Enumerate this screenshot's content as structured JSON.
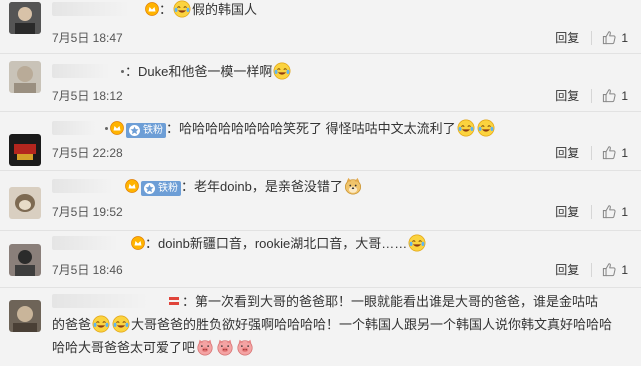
{
  "comments": [
    {
      "name_width": 88,
      "sep": "：",
      "pre_emoji": "",
      "text": "假的韩国人",
      "post_emojis": [],
      "date": "7月5日 18:47",
      "reply_label": "回复",
      "like_count": "1"
    },
    {
      "sep": "：",
      "text": "Duke和他爸一模一样啊",
      "date": "7月5日 18:12",
      "reply_label": "回复",
      "like_count": "1"
    },
    {
      "sep": "：",
      "text": "哈哈哈哈哈哈哈哈笑死了 得怪咕咕中文太流利了",
      "badge": "铁粉",
      "date": "7月5日 22:28",
      "reply_label": "回复",
      "like_count": "1"
    },
    {
      "sep": "：",
      "text": "老年doinb，是亲爸没错了",
      "badge": "铁粉",
      "date": "7月5日 19:52",
      "reply_label": "回复",
      "like_count": "1"
    },
    {
      "sep": "：",
      "text": "doinb新疆口音，rookie湖北口音，大哥……",
      "date": "7月5日 18:46",
      "reply_label": "回复",
      "like_count": "1"
    },
    {
      "sep": "：",
      "line1": "第一次看到大哥的爸爸耶！一眼就能看出谁是大哥的爸爸，谁是金咕咕",
      "line2_a": "的爸爸",
      "line2_b": "大哥爸爸的胜负欲好强啊哈哈哈哈！一个韩国人跟另一个韩国人说你韩文真好哈哈哈",
      "line3": "哈哈大哥爸爸太可爱了吧"
    }
  ],
  "colors": {
    "background": "#f3f3f3",
    "link": "#eb7350",
    "badge": "#6d9ed6",
    "divider": "#e2e2e2"
  },
  "icons": {
    "vip": "gold-crown-icon",
    "like": "thumbs-up-icon",
    "laugh": "laugh-cry-emoji",
    "doge": "doge-emoji",
    "pig": "pig-emoji",
    "red_mark": "red-medal-icon"
  }
}
